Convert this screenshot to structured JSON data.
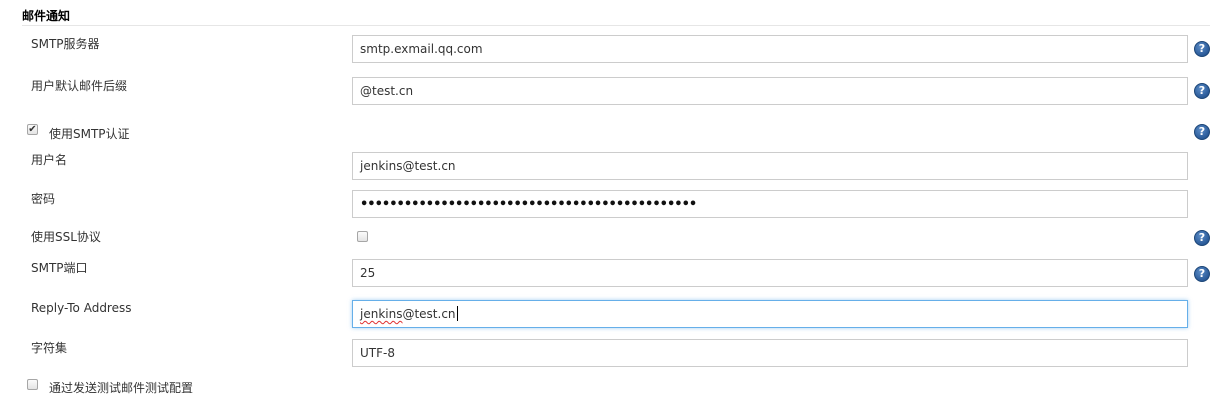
{
  "section": {
    "title": "邮件通知"
  },
  "fields": {
    "smtp_server": {
      "label": "SMTP服务器",
      "value": "smtp.exmail.qq.com"
    },
    "default_suffix": {
      "label": "用户默认邮件后缀",
      "value": "@test.cn"
    },
    "use_smtp_auth": {
      "label": "使用SMTP认证",
      "checked": true,
      "check_glyph": "✔"
    },
    "username": {
      "label": "用户名",
      "value": "jenkins@test.cn"
    },
    "password": {
      "label": "密码",
      "masked": "••••••••••••••••••••••••••••••••••••••••••••••"
    },
    "use_ssl": {
      "label": "使用SSL协议",
      "checked": false
    },
    "smtp_port": {
      "label": "SMTP端口",
      "value": "25"
    },
    "reply_to": {
      "label": "Reply-To Address",
      "value_misspelled": "jenkins",
      "value_rest": "@test.cn"
    },
    "charset": {
      "label": "字符集",
      "value": "UTF-8"
    },
    "test_config": {
      "label": "通过发送测试邮件测试配置",
      "checked": false
    }
  },
  "help": {
    "glyph": "?",
    "icon": "help-icon"
  },
  "colors": {
    "help_blue": "#2a5a98",
    "focus_border": "#66afe9",
    "input_border": "#cccccc",
    "spellcheck_red": "#e03030"
  }
}
